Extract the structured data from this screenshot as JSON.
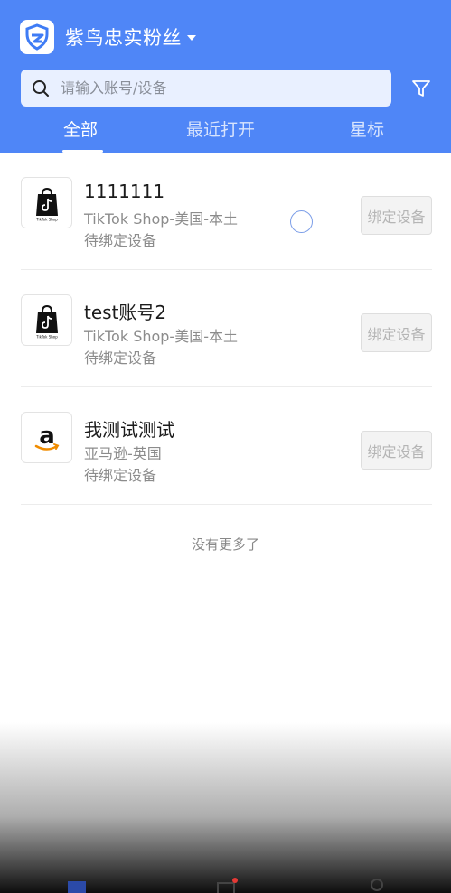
{
  "header": {
    "app_title": "紫鸟忠实粉丝",
    "brand_color": "#4f86f7"
  },
  "search": {
    "placeholder": "请输入账号/设备",
    "value": ""
  },
  "tabs": [
    {
      "label": "全部",
      "active": true
    },
    {
      "label": "最近打开",
      "active": false
    },
    {
      "label": "星标",
      "active": false
    }
  ],
  "accounts": [
    {
      "name": "1111111",
      "platform": "TikTok Shop-美国-本土",
      "status": "待绑定设备",
      "icon": "tiktok-shop-icon",
      "action": "绑定设备"
    },
    {
      "name": "test账号2",
      "platform": "TikTok Shop-美国-本土",
      "status": "待绑定设备",
      "icon": "tiktok-shop-icon",
      "action": "绑定设备"
    },
    {
      "name": "我测试测试",
      "platform": "亚马逊-英国",
      "status": "待绑定设备",
      "icon": "amazon-icon",
      "action": "绑定设备"
    }
  ],
  "list_footer": "没有更多了",
  "bottom_nav": [
    {
      "icon": "store-icon"
    },
    {
      "icon": "shop-icon"
    },
    {
      "icon": "profile-icon"
    }
  ]
}
